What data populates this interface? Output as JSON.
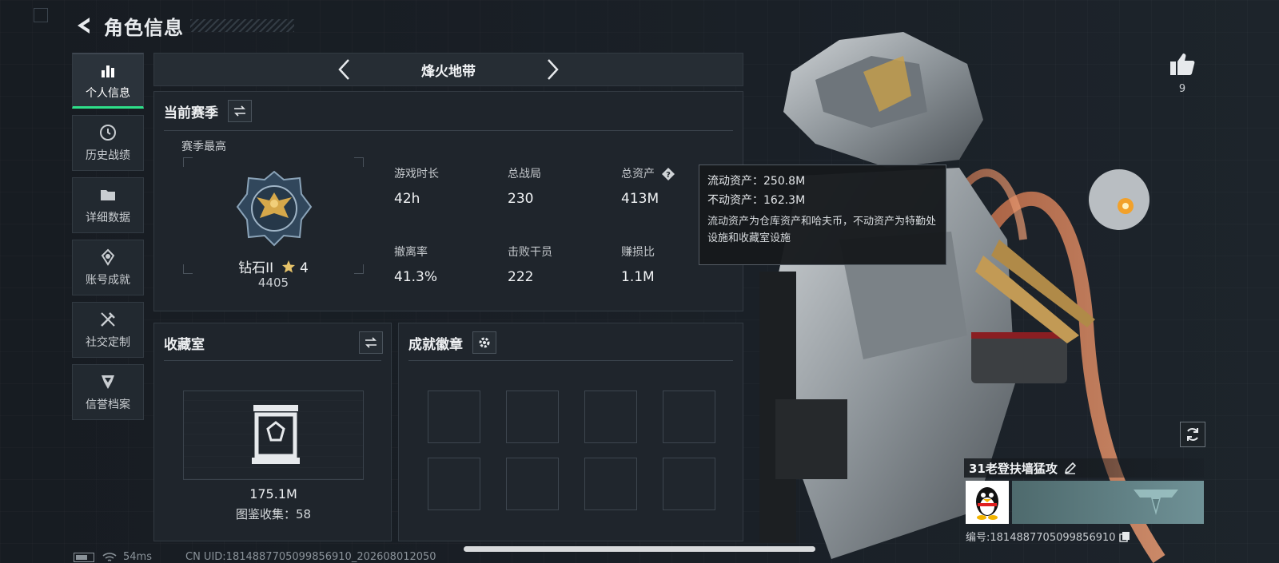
{
  "header": {
    "title": "角色信息"
  },
  "sidebar": {
    "items": [
      {
        "label": "个人信息",
        "icon": "bar-chart-icon",
        "active": true
      },
      {
        "label": "历史战绩",
        "icon": "clock-icon"
      },
      {
        "label": "详细数据",
        "icon": "folder-icon"
      },
      {
        "label": "账号成就",
        "icon": "medal-icon"
      },
      {
        "label": "社交定制",
        "icon": "tools-icon"
      },
      {
        "label": "信誉档案",
        "icon": "shield-icon"
      }
    ]
  },
  "tabbar": {
    "current": "烽火地带"
  },
  "season": {
    "title": "当前赛季",
    "best_label": "赛季最高",
    "rank_name": "钻石II",
    "rank_stars": "4",
    "rank_score": "4405",
    "stats": [
      {
        "label": "游戏时长",
        "value": "42h"
      },
      {
        "label": "总战局",
        "value": "230"
      },
      {
        "label": "总资产",
        "value": "413M"
      },
      {
        "label": "撤离率",
        "value": "41.3%"
      },
      {
        "label": "击败干员",
        "value": "222"
      },
      {
        "label": "赚损比",
        "value": "1.1M"
      }
    ]
  },
  "tooltip": {
    "liquid": "流动资产：250.8M",
    "fixed": "不动资产：162.3M",
    "desc": "流动资产为仓库资产和哈夫币，不动资产为特勤处设施和收藏室设施"
  },
  "collection": {
    "title": "收藏室",
    "value": "175.1M",
    "count": "图鉴收集：58"
  },
  "achievements": {
    "title": "成就徽章"
  },
  "player": {
    "likes": "9",
    "name": "31老登扶墙猛攻",
    "uid": "编号:1814887705099856910"
  },
  "statusbar": {
    "ping": "54ms",
    "cn_uid": "CN UID:1814887705099856910_202608012050"
  },
  "colors": {
    "accent": "#2ee08a",
    "background": "#181d23",
    "panel": "#1f252c"
  }
}
